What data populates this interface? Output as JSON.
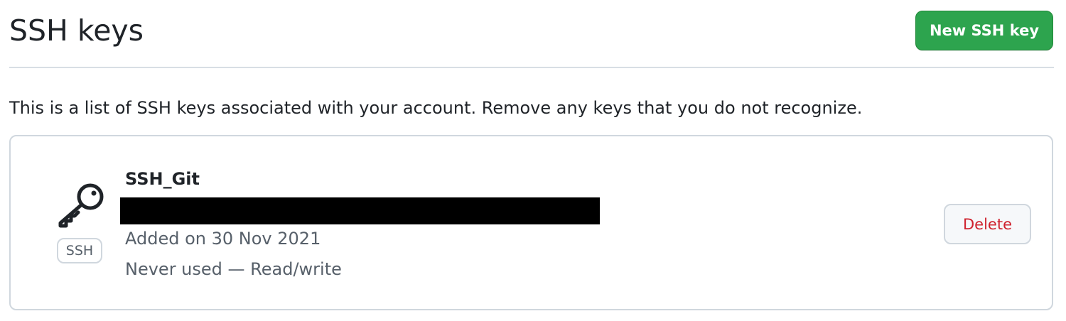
{
  "header": {
    "title": "SSH keys",
    "new_key_label": "New SSH key"
  },
  "description": "This is a list of SSH keys associated with your account. Remove any keys that you do not recognize.",
  "keys": [
    {
      "title": "SSH_Git",
      "type_badge": "SSH",
      "fingerprint_redacted": true,
      "added": "Added on 30 Nov 2021",
      "usage": "Never used — Read/write",
      "delete_label": "Delete",
      "icon": "key-icon"
    }
  ],
  "colors": {
    "primary_button": "#2da44e",
    "danger_text": "#cf222e",
    "muted_text": "#57606a",
    "border": "#d0d7de"
  }
}
